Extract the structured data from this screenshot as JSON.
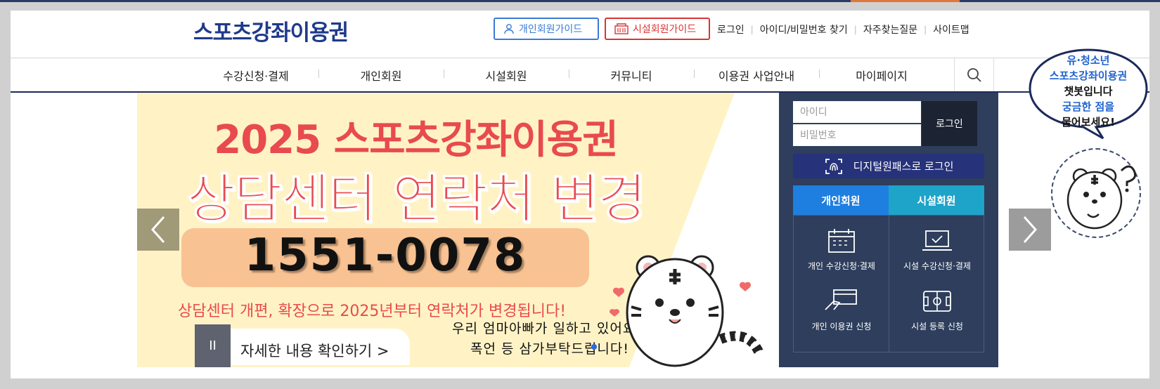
{
  "header": {
    "logo": "스포츠강좌이용권",
    "guide_personal": "개인회원가이드",
    "guide_facility": "시설회원가이드",
    "links": [
      "로그인",
      "아이디/비밀번호 찾기",
      "자주찾는질문",
      "사이트맵"
    ]
  },
  "gnb": {
    "items": [
      "수강신청·결제",
      "개인회원",
      "시설회원",
      "커뮤니티",
      "이용권 사업안내",
      "마이페이지"
    ],
    "search_icon": "search-icon"
  },
  "banner": {
    "line1": "2025 스포츠강좌이용권",
    "line2": "상담센터 연락처 변경",
    "phone": "1551-0078",
    "notice": "상담센터 개편, 확장으로 2025년부터 연락처가 변경됩니다!",
    "detail_link": "자세한 내용 확인하기 >",
    "pause_symbol": "II",
    "handwritten_1": "우리 엄마아빠가 일하고 있어요",
    "handwritten_2": "폭언 등 삼가부탁드립니다!",
    "background": "#fff3c6",
    "title_color": "#e84a4f"
  },
  "login": {
    "id_placeholder": "아이디",
    "pw_placeholder": "비밀번호",
    "login_button": "로그인",
    "digital_onepass": "디지털원패스로 로그인",
    "tab_personal": "개인회원",
    "tab_facility": "시설회원",
    "menu": [
      {
        "label": "개인 수강신청·결제",
        "icon": "calendar-icon"
      },
      {
        "label": "시설 수강신청·결제",
        "icon": "laptop-check-icon"
      },
      {
        "label": "개인 이용권 신청",
        "icon": "card-hand-icon"
      },
      {
        "label": "시설 등록 신청",
        "icon": "stadium-icon"
      }
    ]
  },
  "chatbot": {
    "line1": "유·청소년",
    "line2": "스포츠강좌이용권",
    "line3": "챗봇입니다",
    "line4": "궁금한 점을",
    "line5": "물어보세요!"
  },
  "colors": {
    "brand_navy": "#1f3a8a",
    "panel_bg": "#2e3e5c",
    "tab_personal": "#1e7fe0",
    "tab_facility": "#1ea3c9",
    "onepass": "#26327a"
  }
}
